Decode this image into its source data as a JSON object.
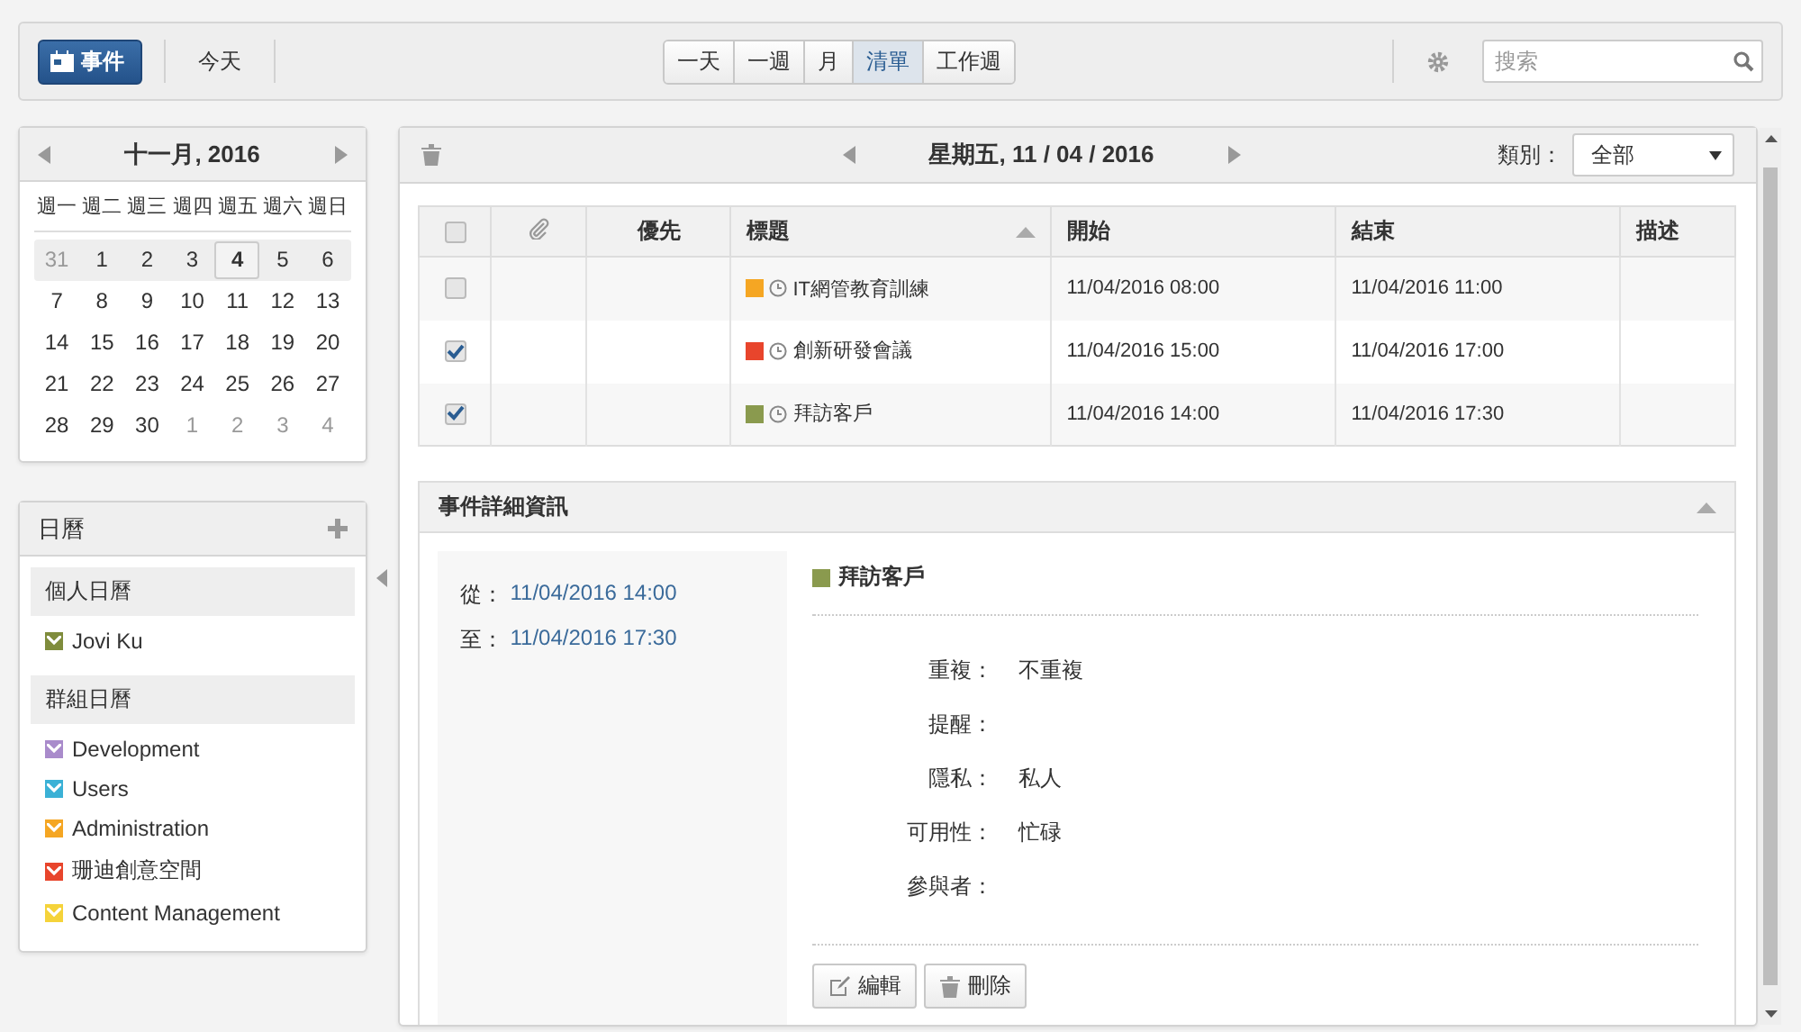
{
  "toolbar": {
    "new_button": "事件",
    "today_button": "今天",
    "views": [
      {
        "label": "一天",
        "selected": false
      },
      {
        "label": "一週",
        "selected": false
      },
      {
        "label": "月",
        "selected": false
      },
      {
        "label": "清單",
        "selected": true
      },
      {
        "label": "工作週",
        "selected": false
      }
    ],
    "search": {
      "placeholder": "搜索"
    }
  },
  "mini_calendar": {
    "title": "十一月, 2016",
    "weekdays": [
      "週一",
      "週二",
      "週三",
      "週四",
      "週五",
      "週六",
      "週日"
    ],
    "weeks": [
      {
        "selected": true,
        "days": [
          {
            "label": "31",
            "muted": true,
            "selected": false
          },
          {
            "label": "1",
            "muted": false,
            "selected": false
          },
          {
            "label": "2",
            "muted": false,
            "selected": false
          },
          {
            "label": "3",
            "muted": false,
            "selected": false
          },
          {
            "label": "4",
            "muted": false,
            "selected": true
          },
          {
            "label": "5",
            "muted": false,
            "selected": false
          },
          {
            "label": "6",
            "muted": false,
            "selected": false
          }
        ]
      },
      {
        "selected": false,
        "days": [
          {
            "label": "7",
            "muted": false,
            "selected": false
          },
          {
            "label": "8",
            "muted": false,
            "selected": false
          },
          {
            "label": "9",
            "muted": false,
            "selected": false
          },
          {
            "label": "10",
            "muted": false,
            "selected": false
          },
          {
            "label": "11",
            "muted": false,
            "selected": false
          },
          {
            "label": "12",
            "muted": false,
            "selected": false
          },
          {
            "label": "13",
            "muted": false,
            "selected": false
          }
        ]
      },
      {
        "selected": false,
        "days": [
          {
            "label": "14",
            "muted": false,
            "selected": false
          },
          {
            "label": "15",
            "muted": false,
            "selected": false
          },
          {
            "label": "16",
            "muted": false,
            "selected": false
          },
          {
            "label": "17",
            "muted": false,
            "selected": false
          },
          {
            "label": "18",
            "muted": false,
            "selected": false
          },
          {
            "label": "19",
            "muted": false,
            "selected": false
          },
          {
            "label": "20",
            "muted": false,
            "selected": false
          }
        ]
      },
      {
        "selected": false,
        "days": [
          {
            "label": "21",
            "muted": false,
            "selected": false
          },
          {
            "label": "22",
            "muted": false,
            "selected": false
          },
          {
            "label": "23",
            "muted": false,
            "selected": false
          },
          {
            "label": "24",
            "muted": false,
            "selected": false
          },
          {
            "label": "25",
            "muted": false,
            "selected": false
          },
          {
            "label": "26",
            "muted": false,
            "selected": false
          },
          {
            "label": "27",
            "muted": false,
            "selected": false
          }
        ]
      },
      {
        "selected": false,
        "days": [
          {
            "label": "28",
            "muted": false,
            "selected": false
          },
          {
            "label": "29",
            "muted": false,
            "selected": false
          },
          {
            "label": "30",
            "muted": false,
            "selected": false
          },
          {
            "label": "1",
            "muted": true,
            "selected": false
          },
          {
            "label": "2",
            "muted": true,
            "selected": false
          },
          {
            "label": "3",
            "muted": true,
            "selected": false
          },
          {
            "label": "4",
            "muted": true,
            "selected": false
          }
        ]
      }
    ]
  },
  "calendars": {
    "title": "日曆",
    "groups": [
      {
        "heading": "個人日曆",
        "items": [
          {
            "name": "Jovi Ku",
            "color": "#7f8c3c",
            "checked": true
          }
        ]
      },
      {
        "heading": "群組日曆",
        "items": [
          {
            "name": "Development",
            "color": "#a98bcb",
            "checked": true
          },
          {
            "name": "Users",
            "color": "#3bb1d6",
            "checked": true
          },
          {
            "name": "Administration",
            "color": "#f5a623",
            "checked": true
          },
          {
            "name": "珊迪創意空間",
            "color": "#e8452c",
            "checked": true
          },
          {
            "name": "Content Management",
            "color": "#f5d33a",
            "checked": true
          }
        ]
      }
    ]
  },
  "events": {
    "date": "星期五, 11 / 04 / 2016",
    "category_label": "類別：",
    "category": "全部",
    "select_all": false,
    "columns": [
      "優先",
      "標題",
      "開始",
      "結束",
      "描述"
    ],
    "rows": [
      {
        "checked": false,
        "color": "#f5a623",
        "title": "IT網管教育訓練",
        "start": "11/04/2016 08:00",
        "end": "11/04/2016 11:00"
      },
      {
        "checked": true,
        "color": "#e8452c",
        "title": "創新研發會議",
        "start": "11/04/2016 15:00",
        "end": "11/04/2016 17:00"
      },
      {
        "checked": true,
        "color": "#8a9a4e",
        "title": "拜訪客戶",
        "start": "11/04/2016 14:00",
        "end": "11/04/2016 17:30"
      }
    ]
  },
  "details": {
    "title": "事件詳細資訊",
    "from_label": "從：",
    "from": "11/04/2016 14:00",
    "to_label": "至：",
    "to": "11/04/2016 17:30",
    "event_title": "拜訪客戶",
    "color": "#8a9a4e",
    "fields": [
      {
        "label": "重複：",
        "value": "不重複"
      },
      {
        "label": "提醒："
      },
      {
        "label": "隱私：",
        "value": "私人"
      },
      {
        "label": "可用性：",
        "value": "忙碌"
      },
      {
        "label": "參與者："
      }
    ],
    "buttons": [
      {
        "kind": "edit",
        "label": "編輯"
      },
      {
        "kind": "delete",
        "label": "刪除"
      }
    ]
  }
}
